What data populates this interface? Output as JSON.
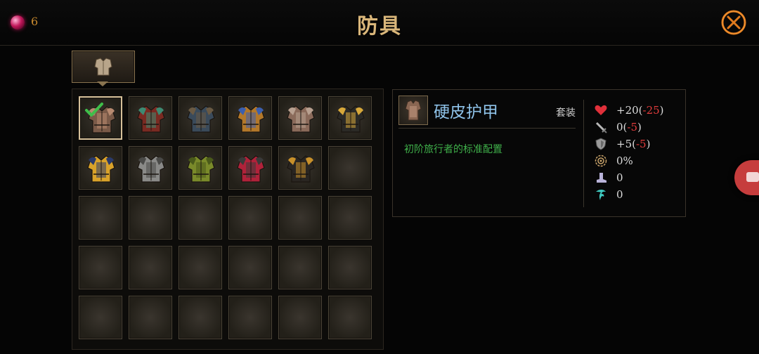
{
  "header": {
    "title": "防具",
    "gem_count": "6"
  },
  "item": {
    "name": "硬皮护甲",
    "set_label": "套装",
    "description": "初阶旅行者的标准配置"
  },
  "stats": [
    {
      "icon": "heart-icon",
      "base": "+20(",
      "delta": "-25",
      "close": ")"
    },
    {
      "icon": "sword-icon",
      "base": "0(",
      "delta": "-5",
      "close": ")"
    },
    {
      "icon": "shield-icon",
      "base": "+5(",
      "delta": "-5",
      "close": ")"
    },
    {
      "icon": "crit-gear-icon",
      "base": "0%",
      "delta": "",
      "close": ""
    },
    {
      "icon": "boot-icon",
      "base": "0",
      "delta": "",
      "close": ""
    },
    {
      "icon": "dodge-wing-icon",
      "base": "0",
      "delta": "",
      "close": ""
    }
  ],
  "inventory": [
    {
      "armor": "leather-armor-icon",
      "colors": [
        "#7a5a48",
        "#b88a70"
      ],
      "selected": true
    },
    {
      "armor": "red-green-armor-icon",
      "colors": [
        "#7a2a22",
        "#3e8a72"
      ]
    },
    {
      "armor": "blue-steel-armor-icon",
      "colors": [
        "#3a4a5a",
        "#6a5a44"
      ]
    },
    {
      "armor": "gold-blue-armor-icon",
      "colors": [
        "#b3782a",
        "#3c5fae"
      ]
    },
    {
      "armor": "bronze-plate-armor-icon",
      "colors": [
        "#8a6a5a",
        "#b8a090"
      ]
    },
    {
      "armor": "gold-dark-armor-icon",
      "colors": [
        "#2b2a26",
        "#d7a83a"
      ]
    },
    {
      "armor": "golden-lion-armor-icon",
      "colors": [
        "#d9a22a",
        "#2a3a6a"
      ]
    },
    {
      "armor": "steel-plate-armor-icon",
      "colors": [
        "#8a8a88",
        "#4a4a48"
      ]
    },
    {
      "armor": "green-ornate-armor-icon",
      "colors": [
        "#7a8a2a",
        "#4a5a1a"
      ]
    },
    {
      "armor": "crimson-armor-icon",
      "colors": [
        "#b0223a",
        "#3a3a3a"
      ]
    },
    {
      "armor": "dark-gold-armor-icon",
      "colors": [
        "#2a2622",
        "#c8902a"
      ]
    },
    {
      "armor": "empty"
    },
    {
      "armor": "empty"
    },
    {
      "armor": "empty"
    },
    {
      "armor": "empty"
    },
    {
      "armor": "empty"
    },
    {
      "armor": "empty"
    },
    {
      "armor": "empty"
    },
    {
      "armor": "empty"
    },
    {
      "armor": "empty"
    },
    {
      "armor": "empty"
    },
    {
      "armor": "empty"
    },
    {
      "armor": "empty"
    },
    {
      "armor": "empty"
    },
    {
      "armor": "empty"
    },
    {
      "armor": "empty"
    },
    {
      "armor": "empty"
    },
    {
      "armor": "empty"
    },
    {
      "armor": "empty"
    },
    {
      "armor": "empty"
    }
  ],
  "colors": {
    "title": "#d9b67a",
    "item_name": "#8fc3ea",
    "description": "#3fb04a",
    "penalty": "#e23c3c",
    "gem": "#c2185b"
  }
}
